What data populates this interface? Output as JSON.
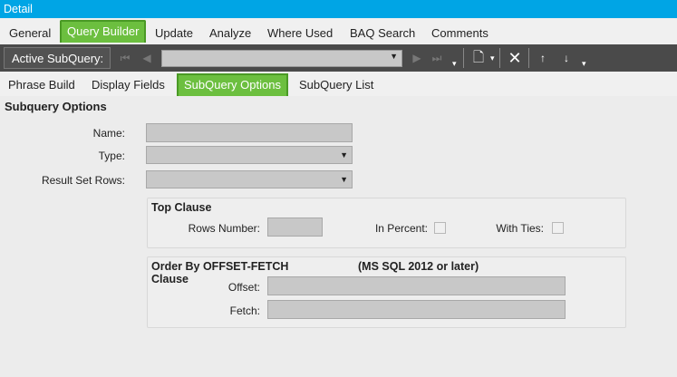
{
  "window": {
    "title": "Detail"
  },
  "main_tabs": [
    "General",
    "Query Builder",
    "Update",
    "Analyze",
    "Where Used",
    "BAQ Search",
    "Comments"
  ],
  "toolbar": {
    "active_subquery_label": "Active SubQuery:"
  },
  "sub_tabs": [
    "Phrase Build",
    "Display Fields",
    "SubQuery Options",
    "SubQuery List"
  ],
  "options": {
    "section_title": "Subquery Options",
    "name_label": "Name:",
    "type_label": "Type:",
    "result_set_rows_label": "Result Set Rows:"
  },
  "top_clause": {
    "title": "Top Clause",
    "rows_number_label": "Rows Number:",
    "in_percent_label": "In Percent:",
    "with_ties_label": "With Ties:"
  },
  "offset_fetch": {
    "title": "Order By OFFSET-FETCH Clause",
    "note": "(MS  SQL 2012 or later)",
    "offset_label": "Offset:",
    "fetch_label": "Fetch:"
  }
}
